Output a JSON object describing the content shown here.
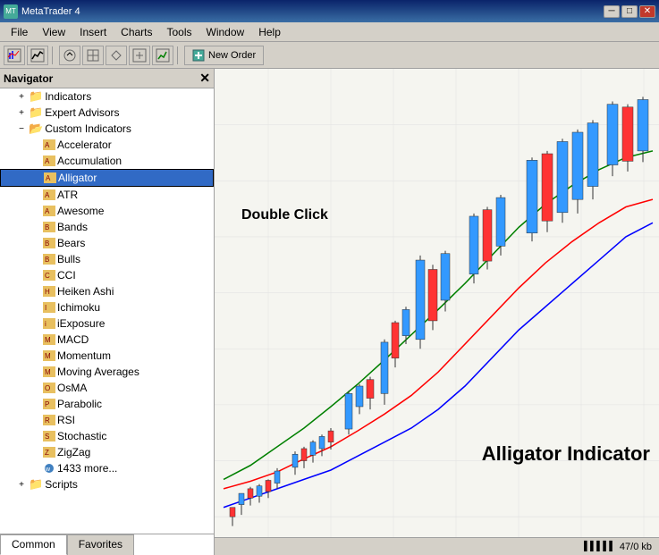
{
  "app": {
    "title": "MetaTrader 4",
    "titlebar": {
      "min": "─",
      "max": "□",
      "close": "✕"
    }
  },
  "menu": {
    "items": [
      "File",
      "View",
      "Insert",
      "Charts",
      "Tools",
      "Window",
      "Help"
    ]
  },
  "toolbar": {
    "new_order_label": "New Order"
  },
  "navigator": {
    "title": "Navigator",
    "tree": {
      "indicators_label": "Indicators",
      "expert_advisors_label": "Expert Advisors",
      "custom_indicators_label": "Custom Indicators",
      "items": [
        "Accelerator",
        "Accumulation",
        "Alligator",
        "ATR",
        "Awesome",
        "Bands",
        "Bears",
        "Bulls",
        "CCI",
        "Heiken Ashi",
        "Ichimoku",
        "iExposure",
        "MACD",
        "Momentum",
        "Moving Averages",
        "OsMA",
        "Parabolic",
        "RSI",
        "Stochastic",
        "ZigZag",
        "1433 more..."
      ],
      "scripts_label": "Scripts"
    },
    "tabs": [
      "Common",
      "Favorites"
    ]
  },
  "chart": {
    "annotation_double_click": "Double Click",
    "annotation_alligator": "Alligator Indicator",
    "status_bar": "47/0 kb"
  }
}
